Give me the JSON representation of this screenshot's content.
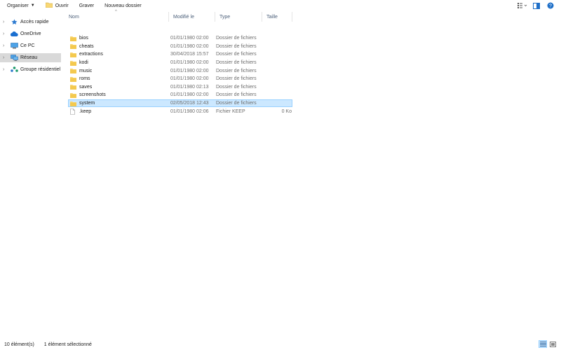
{
  "toolbar": {
    "organize_label": "Organiser",
    "open_label": "Ouvrir",
    "burn_label": "Graver",
    "new_folder_label": "Nouveau dossier"
  },
  "nav": {
    "items": [
      {
        "label": "Accès rapide",
        "icon": "star-icon"
      },
      {
        "label": "OneDrive",
        "icon": "cloud-icon"
      },
      {
        "label": "Ce PC",
        "icon": "computer-icon"
      },
      {
        "label": "Réseau",
        "icon": "network-icon"
      },
      {
        "label": "Groupe résidentiel",
        "icon": "homegroup-icon"
      }
    ]
  },
  "columns": {
    "name": "Nom",
    "modified": "Modifié le",
    "type": "Type",
    "size": "Taille"
  },
  "files": [
    {
      "name": "bios",
      "modified": "01/01/1980 02:00",
      "type": "Dossier de fichiers",
      "size": ""
    },
    {
      "name": "cheats",
      "modified": "01/01/1980 02:00",
      "type": "Dossier de fichiers",
      "size": ""
    },
    {
      "name": "extractions",
      "modified": "30/04/2018 15:57",
      "type": "Dossier de fichiers",
      "size": ""
    },
    {
      "name": "kodi",
      "modified": "01/01/1980 02:00",
      "type": "Dossier de fichiers",
      "size": ""
    },
    {
      "name": "music",
      "modified": "01/01/1980 02:00",
      "type": "Dossier de fichiers",
      "size": ""
    },
    {
      "name": "roms",
      "modified": "01/01/1980 02:00",
      "type": "Dossier de fichiers",
      "size": ""
    },
    {
      "name": "saves",
      "modified": "01/01/1980 02:13",
      "type": "Dossier de fichiers",
      "size": ""
    },
    {
      "name": "screenshots",
      "modified": "01/01/1980 02:00",
      "type": "Dossier de fichiers",
      "size": ""
    },
    {
      "name": "system",
      "modified": "02/05/2018 12:43",
      "type": "Dossier de fichiers",
      "size": ""
    },
    {
      "name": ".keep",
      "modified": "01/01/1980 02:06",
      "type": "Fichier KEEP",
      "size": "0 Ko"
    }
  ],
  "status": {
    "count": "10 élément(s)",
    "selected": "1 élément sélectionné"
  },
  "colors": {
    "selection_bg": "#cce8ff",
    "selection_border": "#99d1ff",
    "folder": "#f8d775",
    "nav_selected": "#d9d9d9"
  }
}
